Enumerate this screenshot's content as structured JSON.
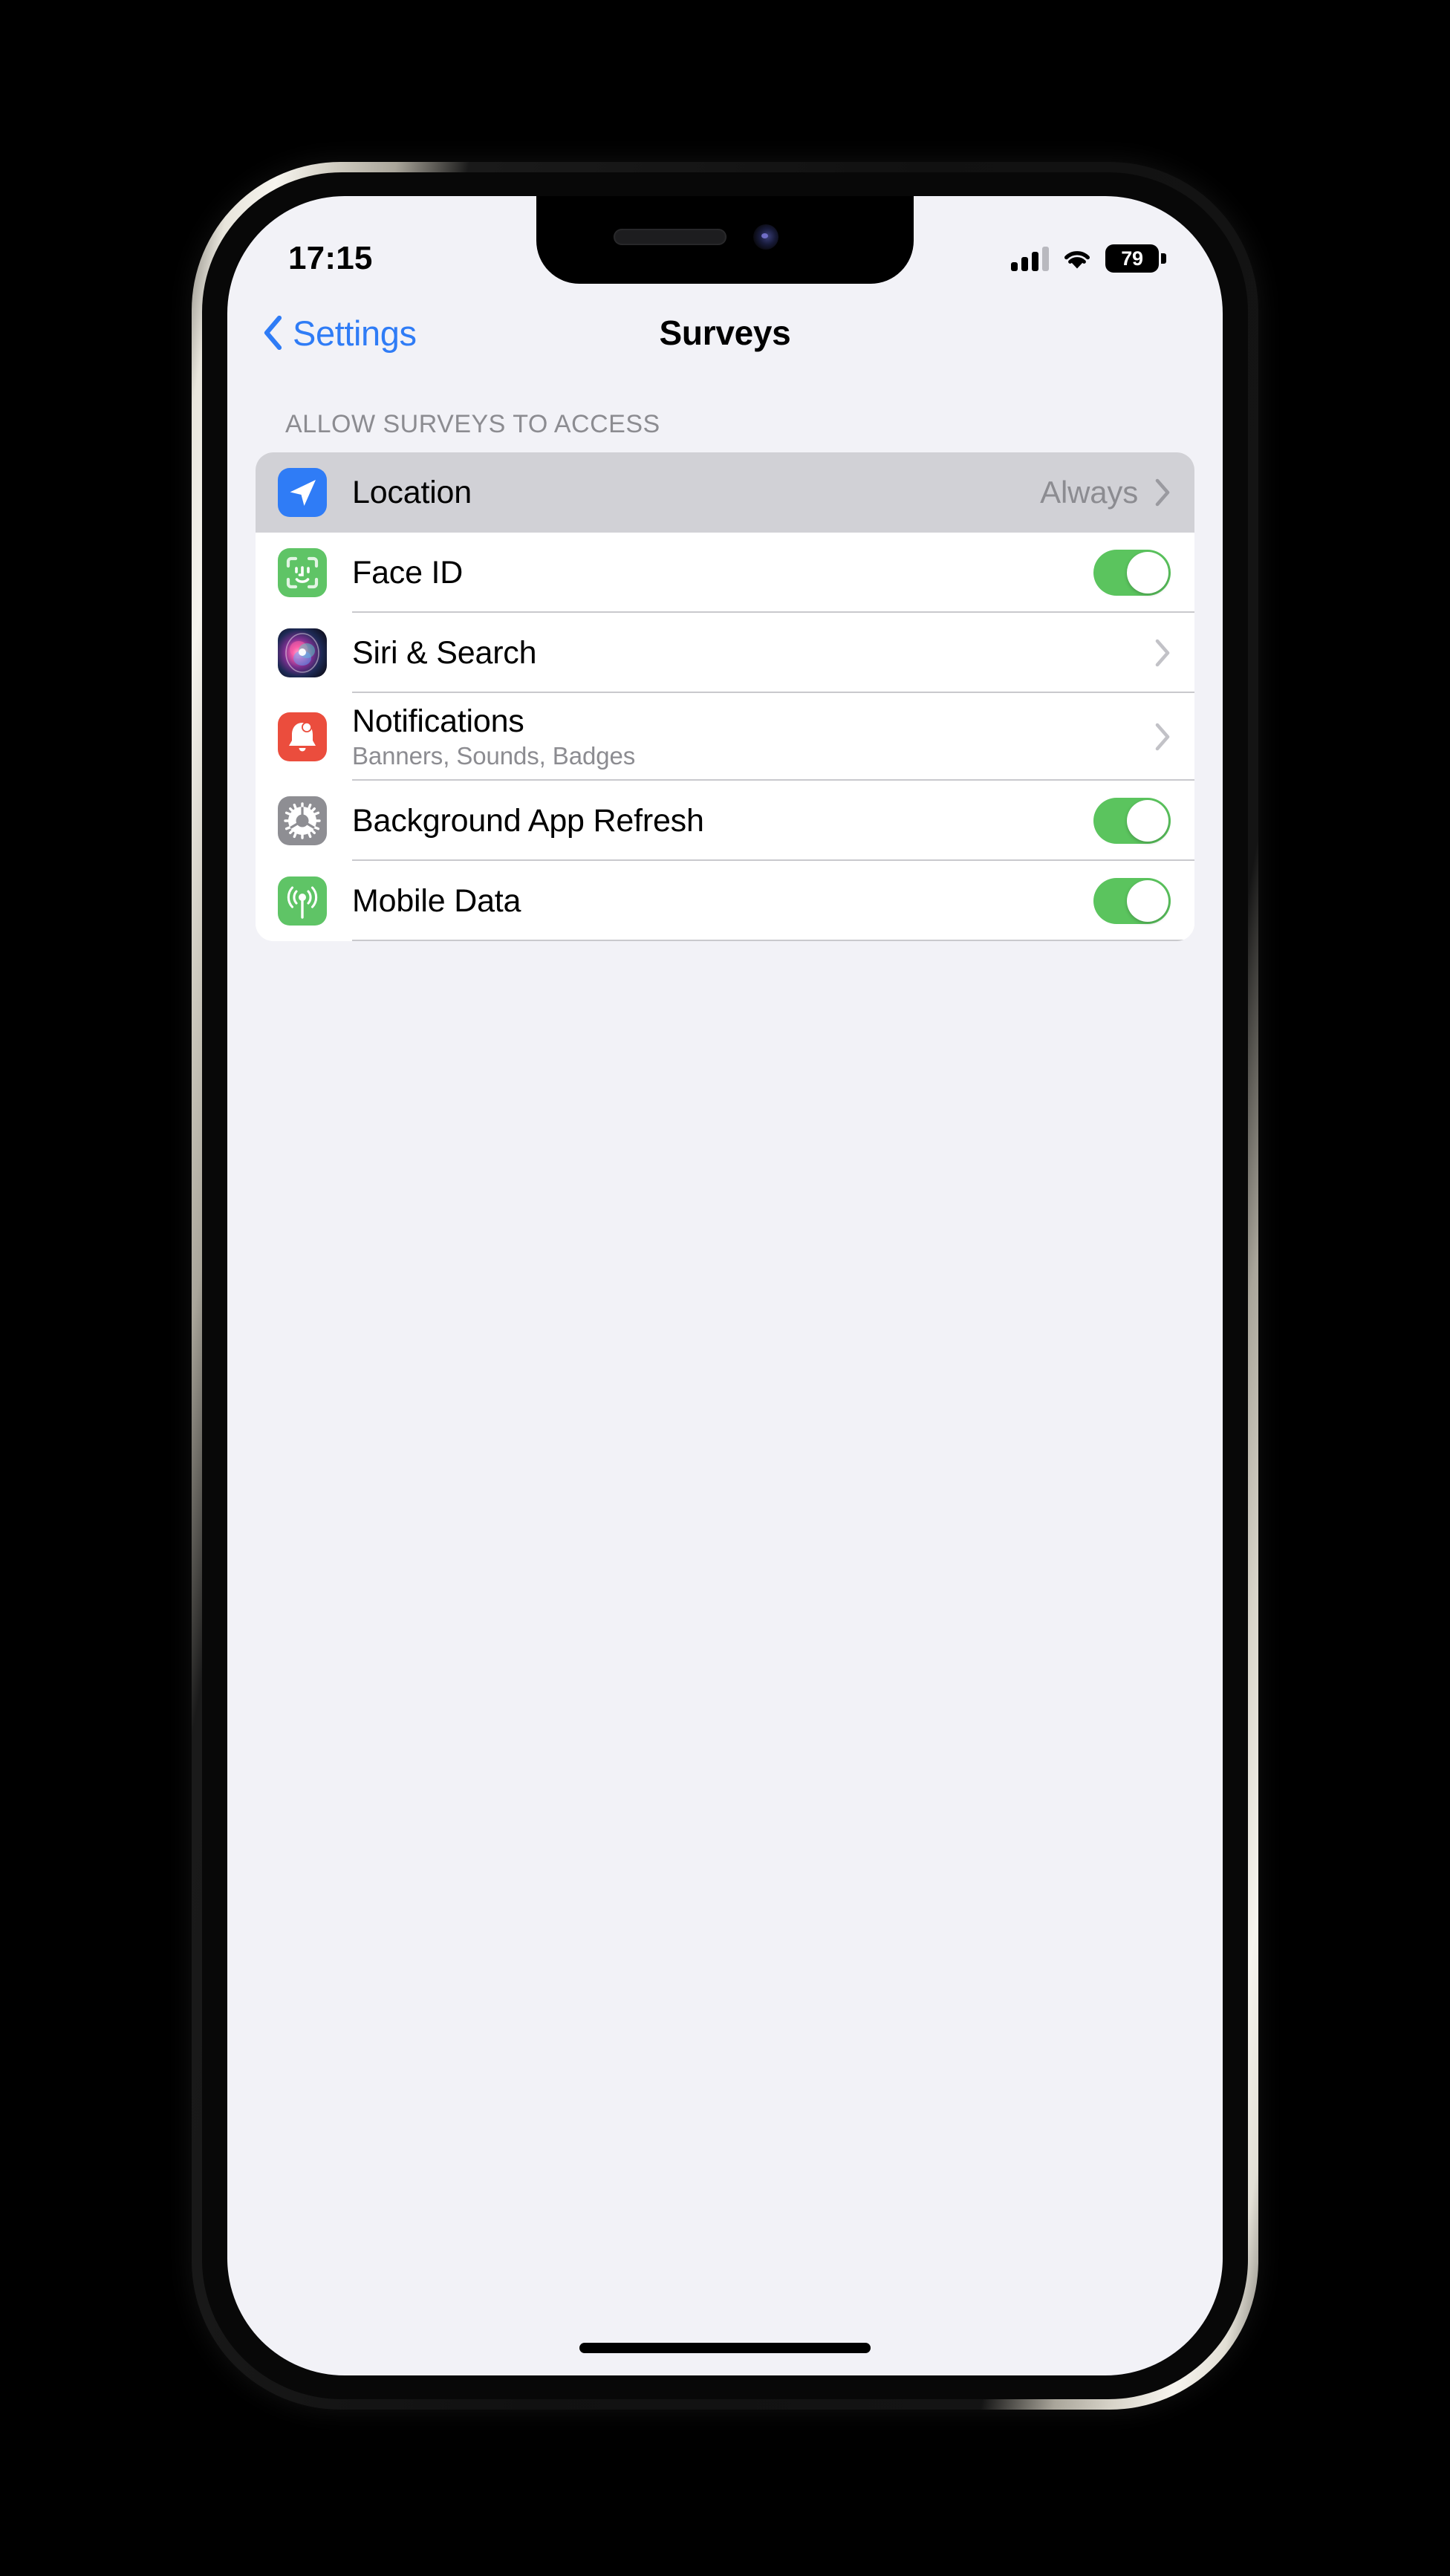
{
  "status_bar": {
    "time": "17:15",
    "signal_icon": "cellular-signal-icon",
    "signal_bars_total": 4,
    "signal_bars_filled": 3,
    "wifi_icon": "wifi-icon",
    "battery_percent": "79",
    "battery_icon": "battery-icon"
  },
  "nav": {
    "back_label": "Settings",
    "back_icon": "chevron-left-icon",
    "title": "Surveys"
  },
  "section": {
    "header": "ALLOW SURVEYS TO ACCESS"
  },
  "rows": [
    {
      "label": "Location",
      "sublabel": "",
      "icon": "location-arrow-icon",
      "icon_class": "ic-location",
      "accessory": "value-chevron",
      "value": "Always",
      "pressed": true,
      "separator": false
    },
    {
      "label": "Face ID",
      "sublabel": "",
      "icon": "face-id-icon",
      "icon_class": "ic-faceid",
      "accessory": "toggle",
      "value": "",
      "toggle_on": true,
      "pressed": false,
      "separator": true
    },
    {
      "label": "Siri & Search",
      "sublabel": "",
      "icon": "siri-orb-icon",
      "icon_class": "ic-siri",
      "accessory": "chevron",
      "value": "",
      "pressed": false,
      "separator": true
    },
    {
      "label": "Notifications",
      "sublabel": "Banners, Sounds, Badges",
      "icon": "bell-icon",
      "icon_class": "ic-notif",
      "accessory": "chevron",
      "value": "",
      "pressed": false,
      "separator": true
    },
    {
      "label": "Background App Refresh",
      "sublabel": "",
      "icon": "gear-icon",
      "icon_class": "ic-gear",
      "accessory": "toggle",
      "value": "",
      "toggle_on": true,
      "pressed": false,
      "separator": true
    },
    {
      "label": "Mobile Data",
      "sublabel": "",
      "icon": "cellular-antenna-icon",
      "icon_class": "ic-cell",
      "accessory": "toggle",
      "value": "",
      "toggle_on": true,
      "pressed": false,
      "separator": false
    }
  ],
  "colors": {
    "accent_blue": "#2f7cf6",
    "toggle_green": "#5bc45e",
    "screen_bg": "#F2F2F7",
    "card_bg": "#FFFFFF",
    "pressed_row": "#D1D1D6",
    "secondary_text": "#8C8C91"
  },
  "home_indicator": "home-indicator"
}
